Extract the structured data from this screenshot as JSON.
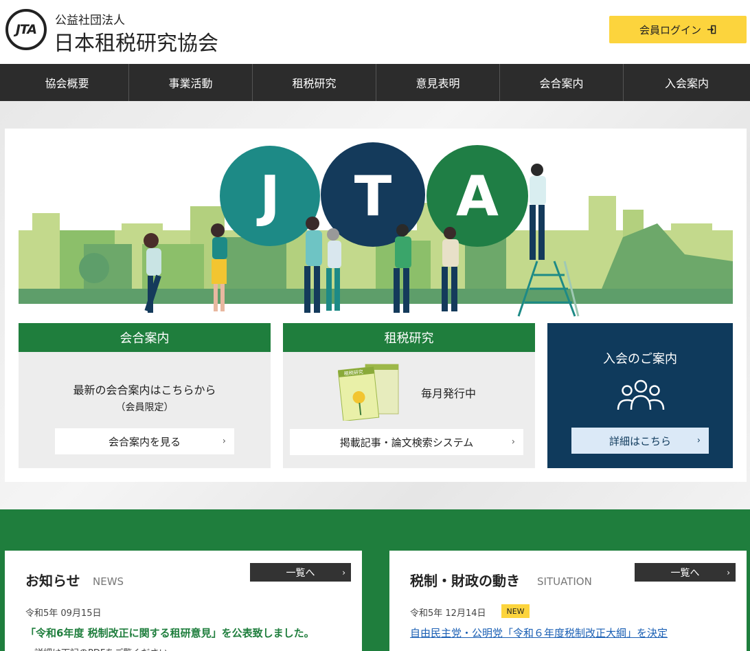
{
  "header": {
    "logo_text": "JTA",
    "org_type": "公益社団法人",
    "org_name": "日本租税研究協会",
    "login_label": "会員ログイン"
  },
  "nav": {
    "items": [
      {
        "label": "協会概要"
      },
      {
        "label": "事業活動"
      },
      {
        "label": "租税研究"
      },
      {
        "label": "意見表明"
      },
      {
        "label": "会合案内"
      },
      {
        "label": "入会案内"
      }
    ]
  },
  "hero": {
    "letters": [
      "J",
      "T",
      "A"
    ],
    "colors": {
      "j": "#1d8a86",
      "t": "#143a5b",
      "a": "#1f7e45",
      "city_light": "#c3d98c",
      "city_mid": "#8cbf6a",
      "city_dark": "#5e9e6a"
    }
  },
  "cards": {
    "meeting": {
      "title": "会合案内",
      "line1": "最新の会合案内はこちらから",
      "line2": "（会員限定）",
      "button": "会合案内を見る"
    },
    "research": {
      "title": "租税研究",
      "monthly": "毎月発行中",
      "book_title": "租税研究",
      "button": "掲載記事・論文検索システム"
    },
    "join": {
      "title": "入会のご案内",
      "button": "詳細はこちら"
    }
  },
  "news": {
    "title": "お知らせ",
    "subtitle": "NEWS",
    "list_button": "一覧へ",
    "date": "令和5年 09月15日",
    "headline": "「令和6年度 税制改正に関する租研意見」を公表致しました。",
    "cut_text": "・詳細は下記のPDFをご覧ください。"
  },
  "situation": {
    "title": "税制・財政の動き",
    "subtitle": "SITUATION",
    "list_button": "一覧へ",
    "date": "令和5年 12月14日",
    "badge": "NEW",
    "headline": "自由民主党・公明党「令和６年度税制改正大綱」を決定"
  },
  "colors": {
    "green": "#1f7e3d",
    "navy": "#0f3a5c",
    "yellow": "#fcd43d",
    "nav_bg": "#2c2c2c"
  }
}
